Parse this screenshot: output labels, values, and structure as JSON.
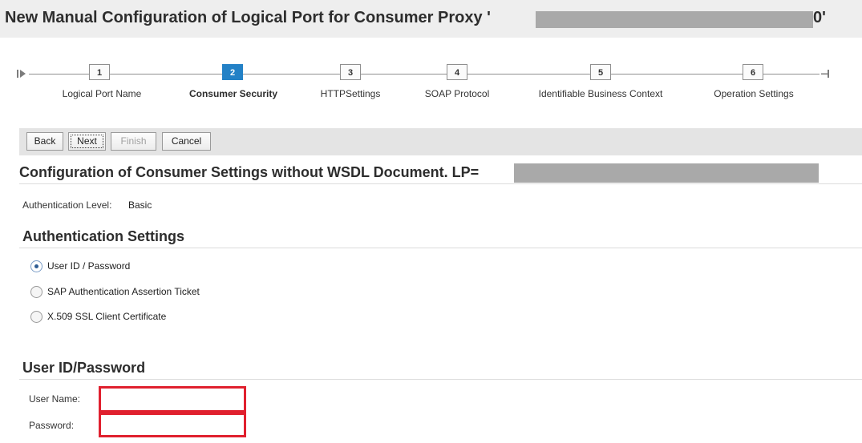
{
  "window": {
    "title": "New Manual Configuration of Logical Port for Consumer Proxy '",
    "title_end": "0'"
  },
  "roadmap": {
    "steps": [
      {
        "number": "1",
        "label": "Logical Port Name",
        "active": false
      },
      {
        "number": "2",
        "label": "Consumer Security",
        "active": true
      },
      {
        "number": "3",
        "label": "HTTPSettings",
        "active": false
      },
      {
        "number": "4",
        "label": "SOAP Protocol",
        "active": false
      },
      {
        "number": "5",
        "label": "Identifiable Business Context",
        "active": false
      },
      {
        "number": "6",
        "label": "Operation Settings",
        "active": false
      }
    ]
  },
  "toolbar": {
    "back_label": "Back",
    "next_label": "Next",
    "finish_label": "Finish",
    "cancel_label": "Cancel"
  },
  "config": {
    "heading": "Configuration of Consumer Settings without WSDL Document. LP="
  },
  "authentication_level": {
    "label": "Authentication Level:",
    "value": "Basic"
  },
  "authentication_settings": {
    "heading": "Authentication Settings",
    "options": [
      {
        "label": "User ID / Password",
        "checked": true
      },
      {
        "label": "SAP Authentication Assertion Ticket",
        "checked": false
      },
      {
        "label": "X.509 SSL Client Certificate",
        "checked": false
      }
    ]
  },
  "credentials": {
    "heading": "User ID/Password",
    "user_name_label": "User Name:",
    "user_name_value": "",
    "password_label": "Password:",
    "password_value": ""
  },
  "colors": {
    "active_step": "#2381c6",
    "highlight_border": "#e0202e",
    "redaction": "#a9a9a9"
  }
}
